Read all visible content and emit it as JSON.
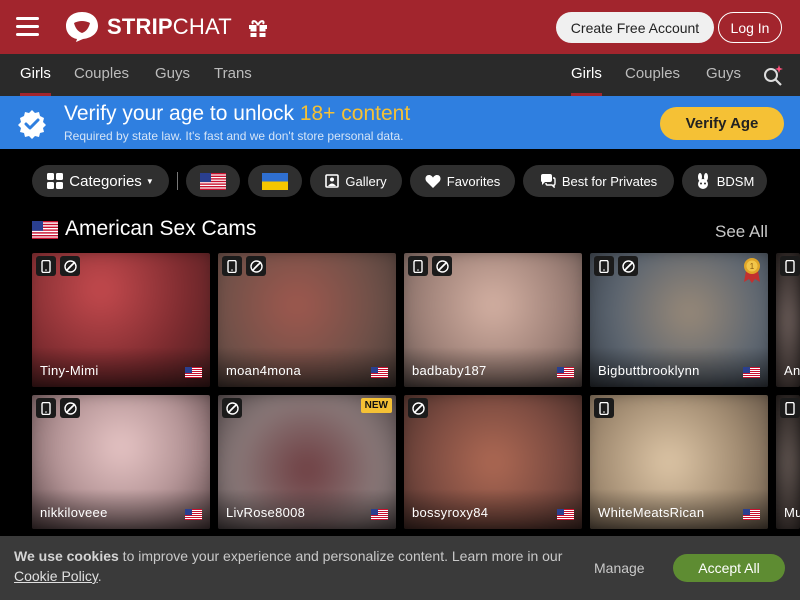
{
  "header": {
    "logo_bold": "STRIP",
    "logo_regular": "CHAT",
    "create_account": "Create Free Account",
    "login": "Log In",
    "brand_color": "#a2252d"
  },
  "nav": {
    "left_tabs": [
      "Girls",
      "Couples",
      "Guys",
      "Trans"
    ],
    "right_tabs": [
      "Girls",
      "Couples",
      "Guys"
    ],
    "active_left": "Girls",
    "active_right": "Girls"
  },
  "verify": {
    "title_prefix": "Verify your age to unlock ",
    "title_highlight": "18+ content",
    "subtitle": "Required by state law. It's fast and we don't store personal data.",
    "button": "Verify Age",
    "banner_color": "#2f7fe0",
    "highlight_color": "#f5c135"
  },
  "filters": {
    "categories": "Categories",
    "gallery": "Gallery",
    "favorites": "Favorites",
    "best_for_privates": "Best for Privates",
    "bdsm": "BDSM"
  },
  "section": {
    "title": "American Sex Cams",
    "see_all": "See All"
  },
  "cards": [
    {
      "name": "Tiny-Mimi",
      "mobile": true,
      "private": true,
      "new": false,
      "medal": false
    },
    {
      "name": "moan4mona",
      "mobile": true,
      "private": true,
      "new": false,
      "medal": false
    },
    {
      "name": "badbaby187",
      "mobile": true,
      "private": true,
      "new": false,
      "medal": false
    },
    {
      "name": "Bigbuttbrooklynn",
      "mobile": true,
      "private": true,
      "new": false,
      "medal": true
    },
    {
      "name": "nikkiloveee",
      "mobile": true,
      "private": true,
      "new": false,
      "medal": false
    },
    {
      "name": "LivRose8008",
      "mobile": false,
      "private": true,
      "new": true,
      "medal": false
    },
    {
      "name": "bossyroxy84",
      "mobile": false,
      "private": true,
      "new": false,
      "medal": false
    },
    {
      "name": "WhiteMeatsRican",
      "mobile": true,
      "private": false,
      "new": false,
      "medal": false
    }
  ],
  "card_new_label": "NEW",
  "partial_cards": [
    "An",
    "Mu"
  ],
  "cookie": {
    "bold": "We use cookies",
    "text": " to improve your experience and personalize content. Learn more in our ",
    "link": "Cookie Policy",
    "end": ".",
    "manage": "Manage",
    "accept": "Accept All"
  }
}
